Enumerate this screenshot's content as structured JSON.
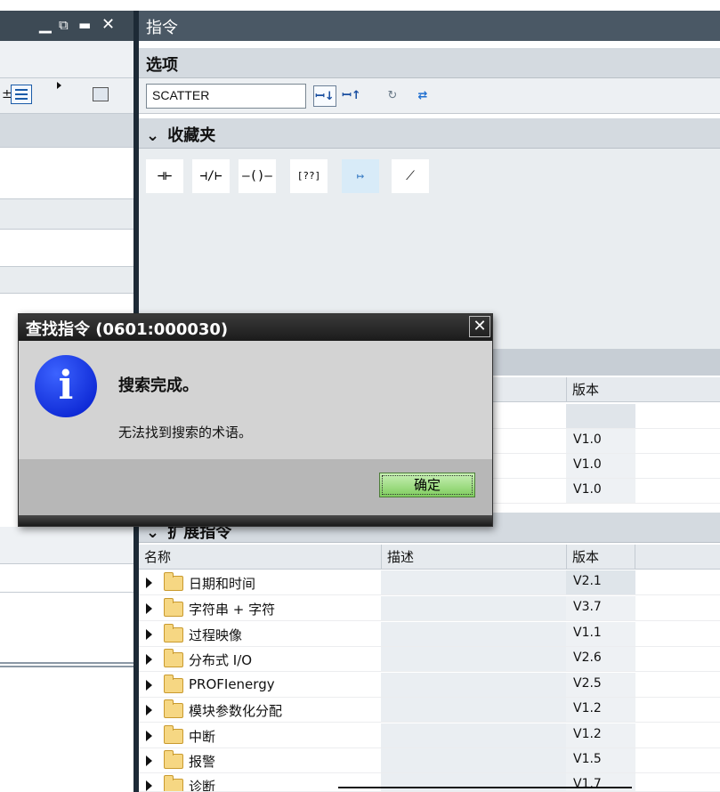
{
  "left_pane": {
    "window_buttons": [
      "▁",
      "⧉",
      "▬",
      "✕"
    ],
    "toolbar_icons": [
      "sort-down-icon",
      "list-icon",
      "flag-icon",
      "panel-icon"
    ]
  },
  "right_pane": {
    "title": "指令",
    "options_header": "选项",
    "search": {
      "value": "SCATTER",
      "placeholder": ""
    },
    "toolbar_buttons": [
      {
        "icon": "search-down-icon",
        "label": "ꟷ↓"
      },
      {
        "icon": "search-up-icon",
        "label": "ꟷ↑"
      },
      {
        "icon": "refresh-icon",
        "label": "↻"
      },
      {
        "icon": "switch-icon",
        "label": "⇄"
      }
    ],
    "favorites": {
      "header": "收藏夹",
      "items": [
        "⊣⊢",
        "⊣/⊢",
        "–()–",
        "[??]",
        "↦",
        "⟋"
      ]
    },
    "basic_table": {
      "version_header": "版本",
      "rows": [
        "",
        "V1.0",
        "V1.0",
        "V1.0"
      ]
    },
    "extended": {
      "header": "扩展指令",
      "col_name": "名称",
      "col_desc": "描述",
      "col_version": "版本",
      "rows": [
        {
          "name": "日期和时间",
          "version": "V2.1"
        },
        {
          "name": "字符串 + 字符",
          "version": "V3.7"
        },
        {
          "name": "过程映像",
          "version": "V1.1"
        },
        {
          "name": "分布式 I/O",
          "version": "V2.6"
        },
        {
          "name": "PROFIenergy",
          "version": "V2.5"
        },
        {
          "name": "模块参数化分配",
          "version": "V1.2"
        },
        {
          "name": "中断",
          "version": "V1.2"
        },
        {
          "name": "报警",
          "version": "V1.5"
        },
        {
          "name": "诊断",
          "version": "V1.7"
        }
      ]
    }
  },
  "dialog": {
    "title": "查找指令 (0601:000030)",
    "close": "✕",
    "heading": "搜索完成。",
    "message": "无法找到搜索的术语。",
    "ok_label": "确定",
    "icon": "info-icon"
  }
}
